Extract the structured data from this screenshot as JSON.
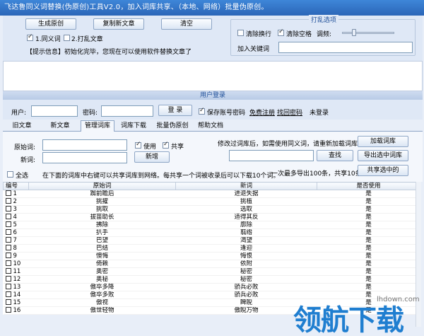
{
  "window": {
    "title": "飞达鲁同义词替换(伪原创)工具V2.0，加入词库共享、（本地、网络）批量伪原创。"
  },
  "toolbar": {
    "generate_label": "生成原创",
    "copy_label": "复制新文章",
    "clear_label": "清空",
    "synonym_label": "1.同义词",
    "shuffle_label": "2.打乱文章"
  },
  "status": {
    "message": "【提示信息】初始化完毕，您现在可以使用软件替换文章了"
  },
  "shuffle_options": {
    "title": "打乱选项",
    "remove_newline_label": "清除换行",
    "remove_space_label": "清除空格",
    "frequency_label": "调频:",
    "keyword_label": "加入关键词",
    "frequency_level": 0.2
  },
  "login": {
    "section_title": "用户登录",
    "user_label": "用户:",
    "password_label": "密码:",
    "login_button": "登 录",
    "save_account_label": "保存账号密码",
    "register_link": "免费注册",
    "recover_link": "找回密码",
    "status": "未登录"
  },
  "tabs": [
    "旧文章",
    "新文章",
    "管理词库",
    "词库下载",
    "批量伪原创",
    "帮助文档"
  ],
  "manage": {
    "original_label": "原始词:",
    "new_label": "新词:",
    "use_label": "使用",
    "share_label": "共享",
    "add_button": "新增",
    "notice": "修改过词库后，如需使用同义词，请重新加载词库。",
    "load_button": "加载词库",
    "search_button": "查找",
    "export_button": "导出选中词库",
    "share_selected_button": "共享选中的",
    "select_all_label": "全选",
    "hint_text": "在下面的词库中右键可以共享词库到网络。每共享一个词被收录后可以下载10个词。",
    "limit_text": "一次最多导出100条，共享10条。"
  },
  "table": {
    "headers": [
      "编号",
      "原始词",
      "新词",
      "是否使用"
    ],
    "rows": [
      [
        "1",
        "踟前瞻后",
        "进退失据",
        "是"
      ],
      [
        "2",
        "挑擢",
        "挑植",
        "是"
      ],
      [
        "3",
        "挑取",
        "选取",
        "是"
      ],
      [
        "4",
        "拔苗助长",
        "适得其反",
        "是"
      ],
      [
        "5",
        "拂除",
        "廓除",
        "是"
      ],
      [
        "6",
        "扒手",
        "翦绺",
        "是"
      ],
      [
        "7",
        "巴望",
        "渴望",
        "是"
      ],
      [
        "8",
        "巴结",
        "逢迎",
        "是"
      ],
      [
        "9",
        "懊悔",
        "悔恨",
        "是"
      ],
      [
        "10",
        "倚赖",
        "依附",
        "是"
      ],
      [
        "11",
        "奥密",
        "秘密",
        "是"
      ],
      [
        "12",
        "奥秘",
        "秘密",
        "是"
      ],
      [
        "13",
        "傲卒多降",
        "骄兵必败",
        "是"
      ],
      [
        "14",
        "傲卒多败",
        "骄兵必败",
        "是"
      ],
      [
        "15",
        "傲视",
        "睥睨",
        "是"
      ],
      [
        "16",
        "傲世轻物",
        "傲睨万物",
        "是"
      ]
    ]
  },
  "watermark": {
    "text": "领航下载",
    "url": "lhdown.com"
  }
}
